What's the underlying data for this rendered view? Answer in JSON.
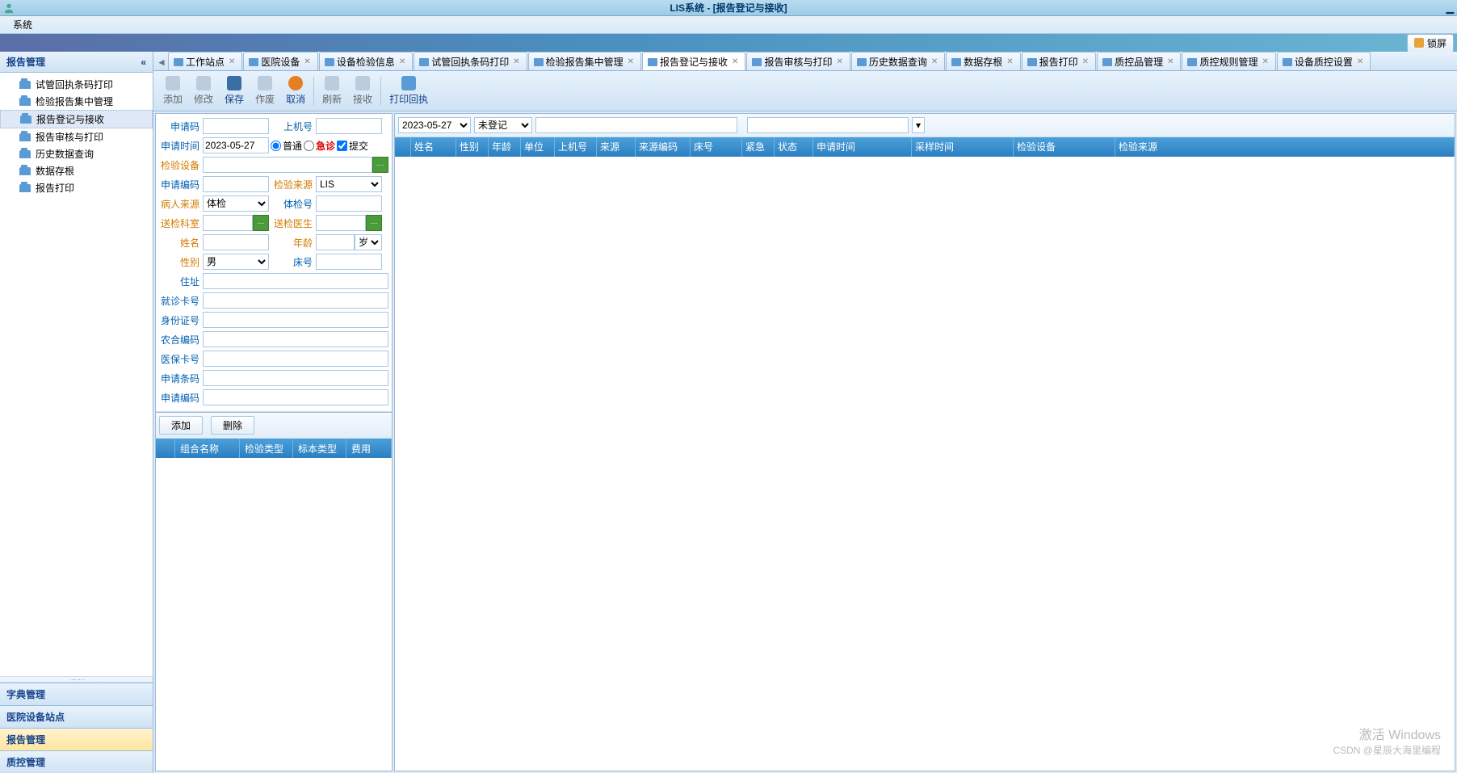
{
  "window": {
    "title": "LIS系统 - [报告登记与接收]"
  },
  "menubar": {
    "system": "系统"
  },
  "lock_button": "锁屏",
  "sidebar": {
    "header": "报告管理",
    "items": [
      {
        "label": "试管回执条码打印"
      },
      {
        "label": "检验报告集中管理"
      },
      {
        "label": "报告登记与接收",
        "active": true
      },
      {
        "label": "报告审核与打印"
      },
      {
        "label": "历史数据查询"
      },
      {
        "label": "数据存根"
      },
      {
        "label": "报告打印"
      }
    ],
    "nav": [
      {
        "label": "字典管理"
      },
      {
        "label": "医院设备站点"
      },
      {
        "label": "报告管理",
        "selected": true
      },
      {
        "label": "质控管理"
      }
    ]
  },
  "tabs": [
    {
      "label": "工作站点"
    },
    {
      "label": "医院设备"
    },
    {
      "label": "设备检验信息"
    },
    {
      "label": "试管回执条码打印"
    },
    {
      "label": "检验报告集中管理"
    },
    {
      "label": "报告登记与接收",
      "active": true
    },
    {
      "label": "报告审核与打印"
    },
    {
      "label": "历史数据查询"
    },
    {
      "label": "数据存根"
    },
    {
      "label": "报告打印"
    },
    {
      "label": "质控品管理"
    },
    {
      "label": "质控规则管理"
    },
    {
      "label": "设备质控设置"
    }
  ],
  "toolbar": {
    "add": "添加",
    "edit": "修改",
    "save": "保存",
    "void": "作废",
    "cancel": "取消",
    "refresh": "刷新",
    "receive": "接收",
    "print": "打印回执"
  },
  "form": {
    "apply_code_label": "申请码",
    "apply_code": "",
    "machine_no_label": "上机号",
    "machine_no": "",
    "apply_time_label": "申请时间",
    "apply_time": "2023-05-27",
    "normal_label": "普通",
    "urgent_label": "急诊",
    "submit_label": "提交",
    "test_device_label": "检验设备",
    "test_device": "",
    "apply_no_label": "申请编码",
    "apply_no": "",
    "test_source_label": "检验来源",
    "test_source": "LIS",
    "patient_source_label": "病人来源",
    "patient_source": "体检",
    "exam_no_label": "体检号",
    "exam_no": "",
    "send_dept_label": "送检科室",
    "send_dept": "",
    "send_doctor_label": "送检医生",
    "send_doctor": "",
    "name_label": "姓名",
    "name": "",
    "age_label": "年龄",
    "age": "",
    "age_unit": "岁",
    "gender_label": "性别",
    "gender": "男",
    "bed_no_label": "床号",
    "bed_no": "",
    "address_label": "住址",
    "address": "",
    "visit_card_label": "就诊卡号",
    "visit_card": "",
    "id_card_label": "身份证号",
    "id_card": "",
    "rural_code_label": "农合编码",
    "rural_code": "",
    "medicare_label": "医保卡号",
    "medicare": "",
    "apply_barcode_label": "申请条码",
    "apply_barcode": "",
    "apply_code2_label": "申请编码",
    "apply_code2": ""
  },
  "sub_toolbar": {
    "add": "添加",
    "delete": "删除"
  },
  "sub_grid_headers": [
    "",
    "组合名称",
    "检验类型",
    "标本类型",
    "费用"
  ],
  "filter": {
    "date": "2023-05-27",
    "status": "未登记"
  },
  "grid_headers": [
    "",
    "姓名",
    "性别",
    "年龄",
    "单位",
    "上机号",
    "来源",
    "来源编码",
    "床号",
    "紧急",
    "状态",
    "申请时间",
    "采样时间",
    "检验设备",
    "检验来源"
  ],
  "watermark": {
    "line1": "激活 Windows",
    "line2": "CSDN @星辰大海里编程"
  }
}
